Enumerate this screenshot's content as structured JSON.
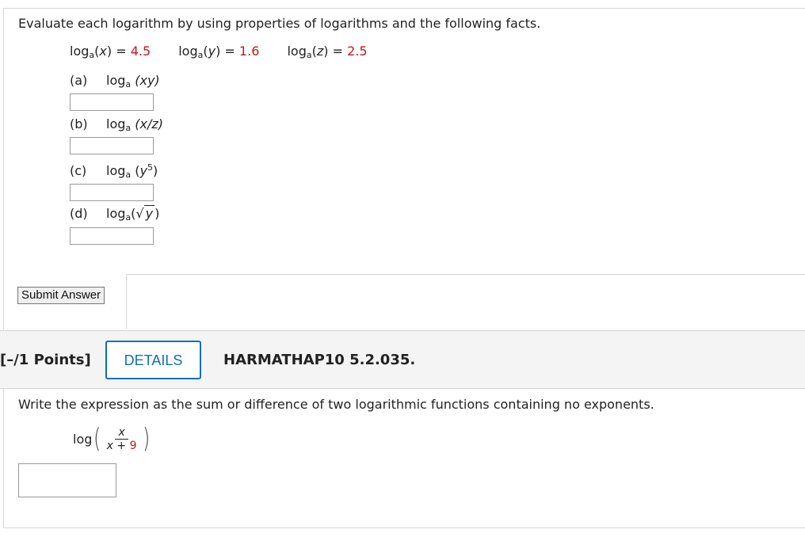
{
  "question1": {
    "intro": "Evaluate each logarithm by using properties of logarithms and the following facts.",
    "facts": [
      {
        "fn": "log",
        "base": "a",
        "arg": "x",
        "eq": " = ",
        "value": "4.5"
      },
      {
        "fn": "log",
        "base": "a",
        "arg": "y",
        "eq": " = ",
        "value": "1.6"
      },
      {
        "fn": "log",
        "base": "a",
        "arg": "z",
        "eq": " = ",
        "value": "2.5"
      }
    ],
    "parts": [
      {
        "label": "(a)",
        "fn": "log",
        "base": "a",
        "arg": "(xy)",
        "answer": ""
      },
      {
        "label": "(b)",
        "fn": "log",
        "base": "a",
        "arg": "(x/z)",
        "answer": ""
      },
      {
        "label": "(c)",
        "fn": "log",
        "base": "a",
        "arg_base": "y",
        "arg_exp": "5",
        "answer": ""
      },
      {
        "label": "(d)",
        "fn": "log",
        "base": "a",
        "arg": "y",
        "answer": ""
      }
    ],
    "submit_label": "Submit Answer"
  },
  "question2": {
    "points": "[–/1 Points]",
    "details_label": "DETAILS",
    "question_id": "HARMATHAP10 5.2.035.",
    "text": "Write the expression as the sum or difference of two logarithmic functions containing no exponents.",
    "expr": {
      "fn": "log",
      "numerator": "x",
      "denominator_var": "x",
      "denominator_op": " + ",
      "denominator_const": "9"
    },
    "answer": ""
  }
}
